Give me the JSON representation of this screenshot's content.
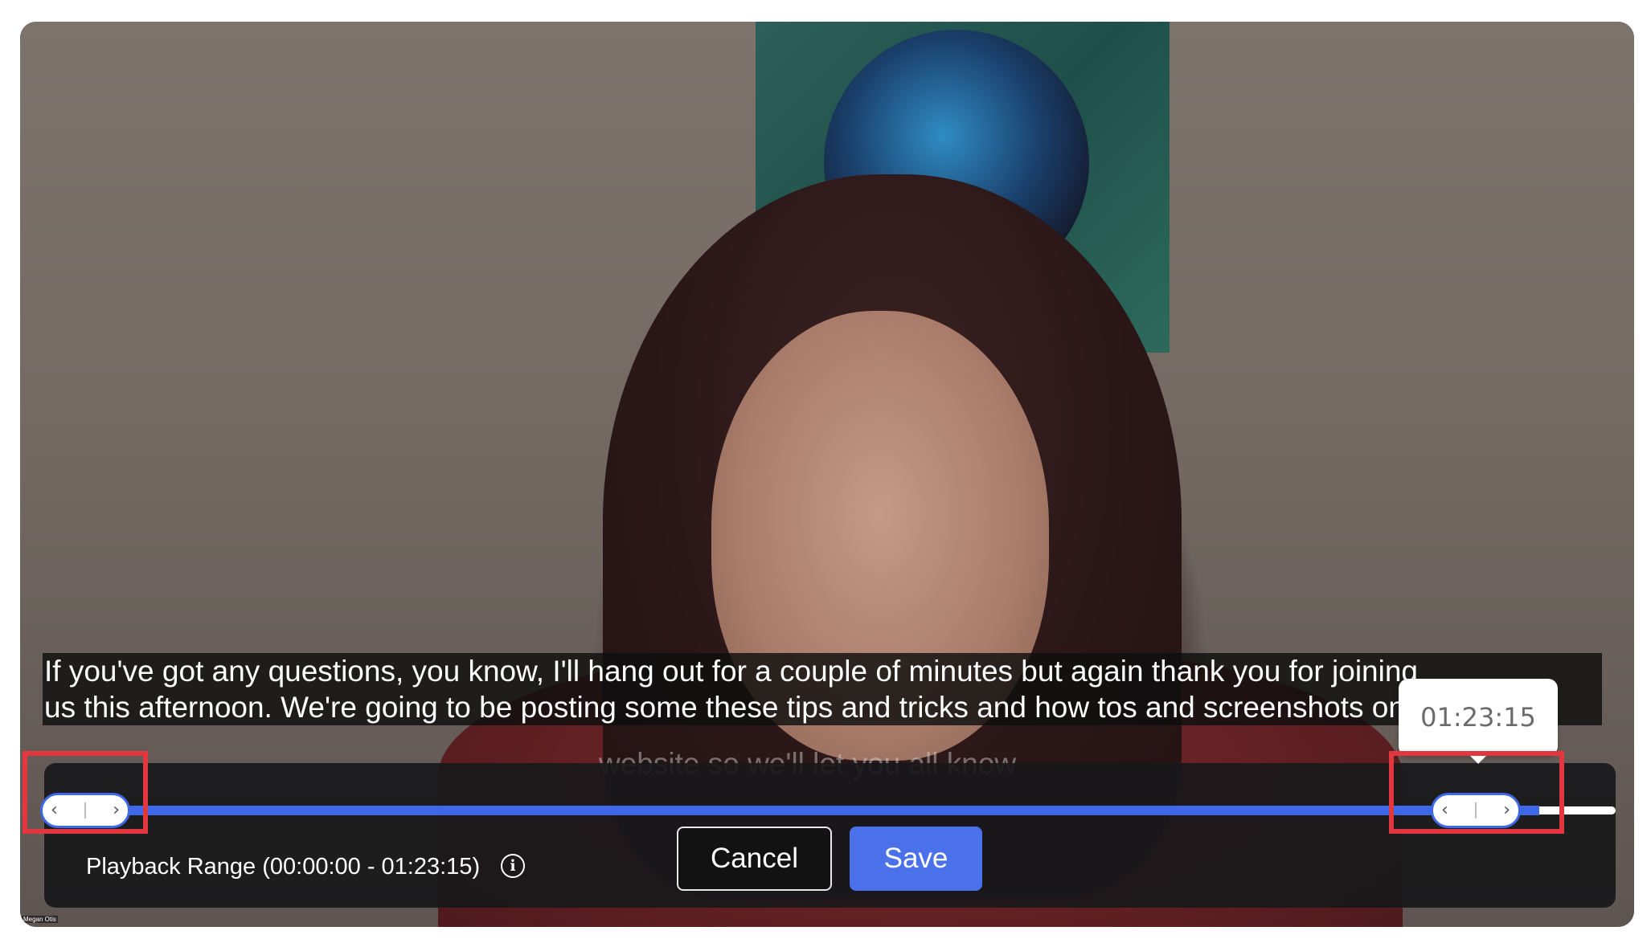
{
  "video": {
    "participant_name": "Megan Otis"
  },
  "captions": {
    "line1": "If you've got any questions, you know, I'll hang out for a couple of minutes but again thank you for joining",
    "line2": "us this afternoon. We're going to be posting some these tips and tricks and how tos and screenshots on our",
    "line3_faded": "website so we'll let you all know"
  },
  "timeline": {
    "tooltip_time": "01:23:15",
    "playback_range_label": "Playback Range (00:00:00 - 01:23:15)",
    "start_handle_icons": [
      "chevron-left-icon",
      "chevron-right-icon"
    ],
    "end_handle_icons": [
      "chevron-left-icon",
      "chevron-right-icon"
    ],
    "accent_color": "#3f68e8",
    "highlight_color": "#e3373f"
  },
  "buttons": {
    "cancel_label": "Cancel",
    "save_label": "Save"
  },
  "icons": {
    "info": "info-icon",
    "info_glyph": "i"
  }
}
